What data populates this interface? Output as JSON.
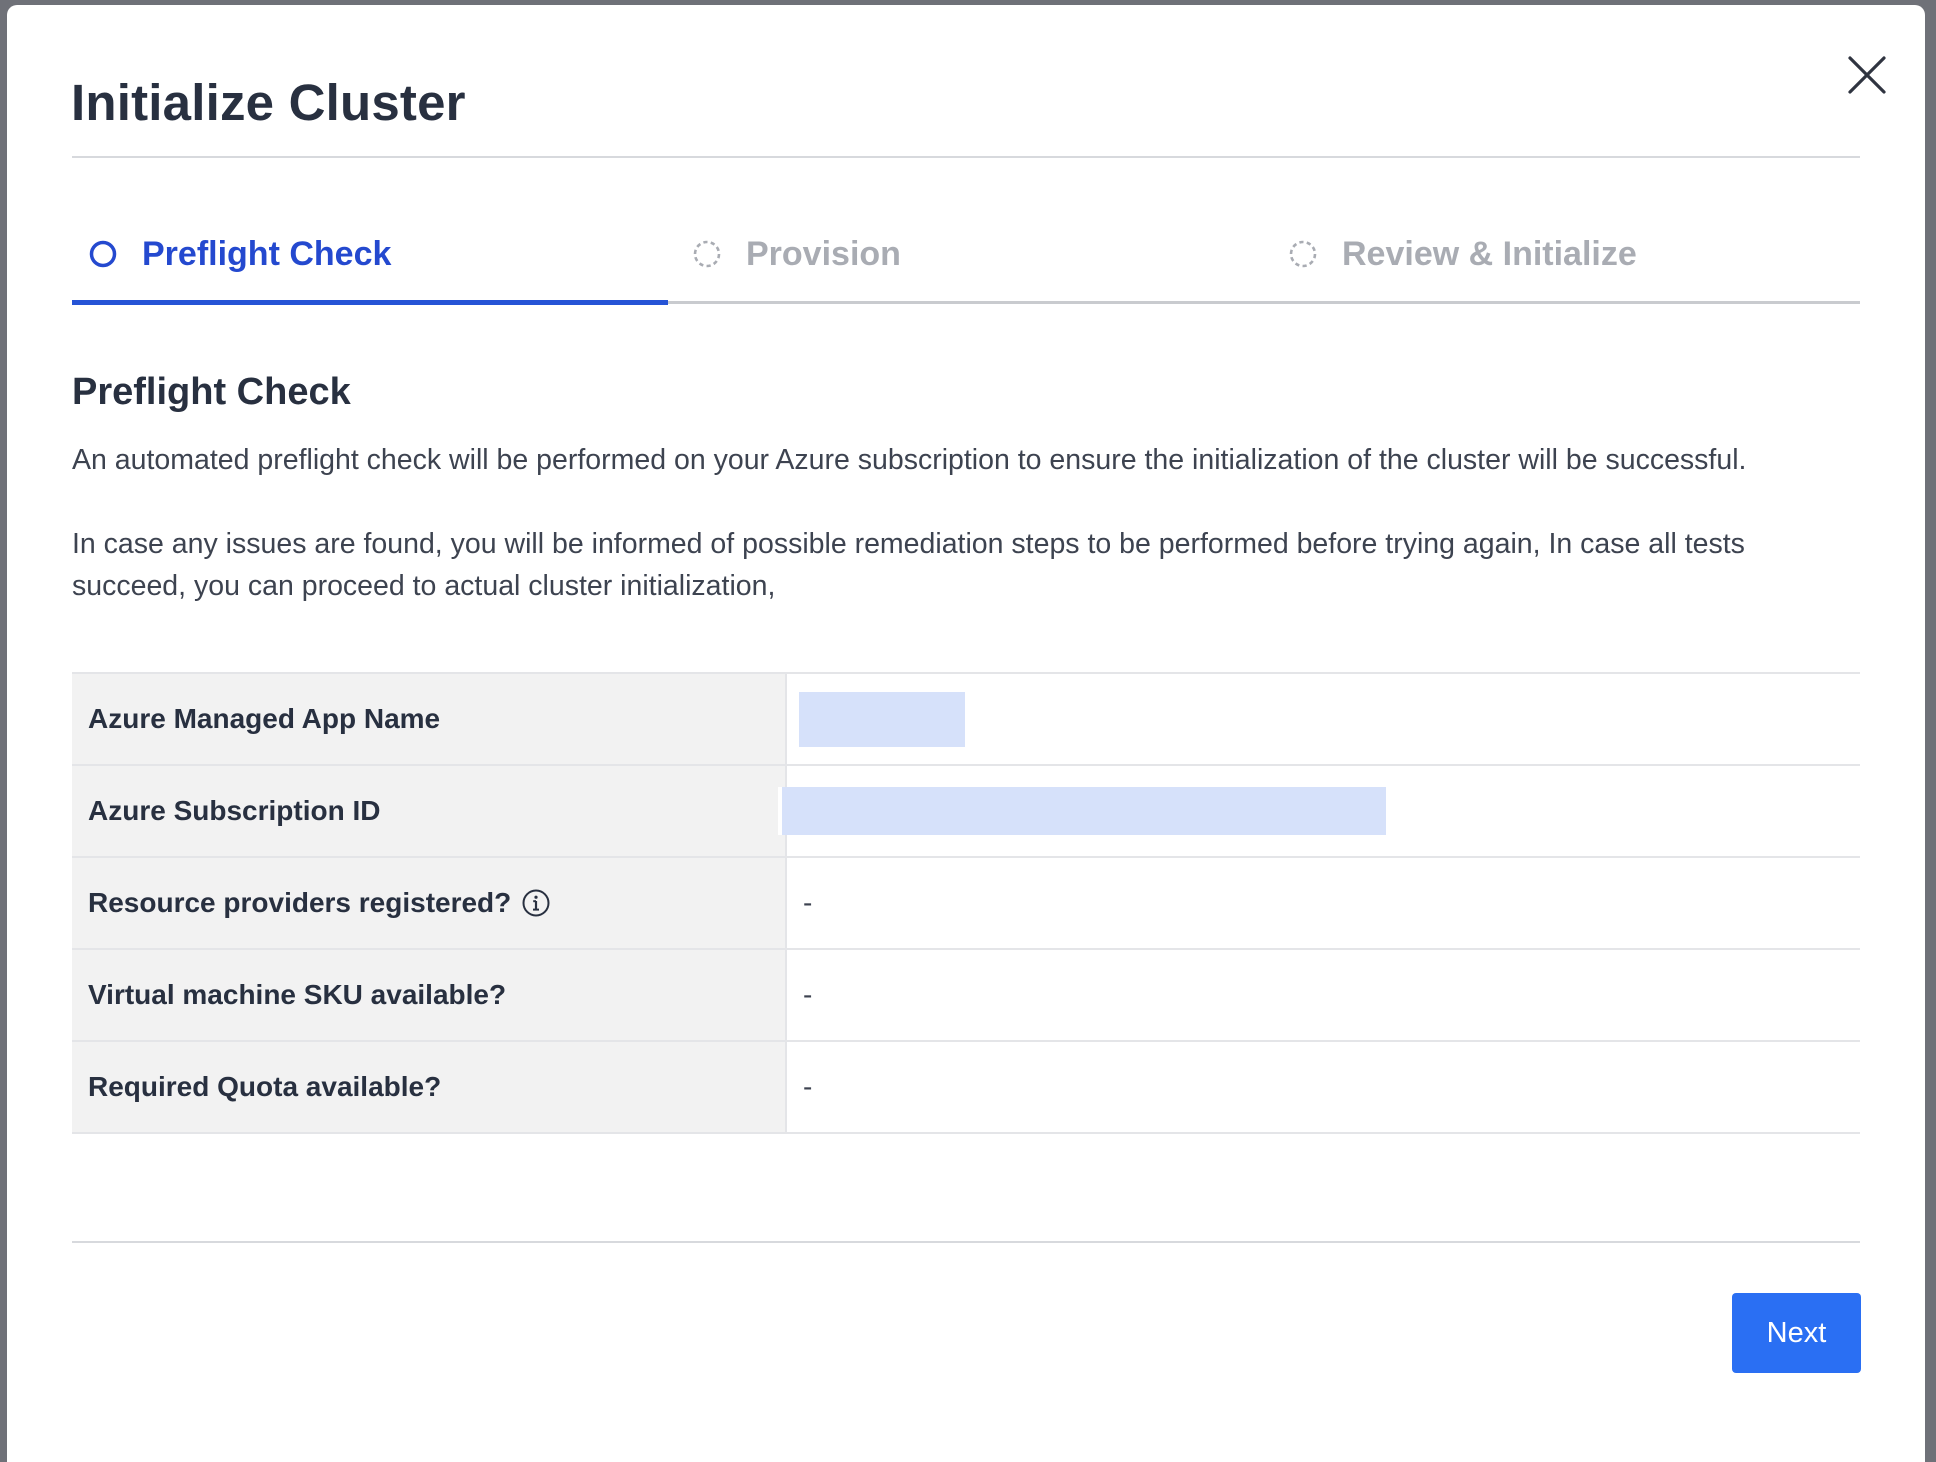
{
  "modal": {
    "title": "Initialize Cluster",
    "close_icon": "close-icon"
  },
  "steps": [
    {
      "label": "Preflight Check",
      "state": "active",
      "icon": "circle-outline-icon"
    },
    {
      "label": "Provision",
      "state": "pending",
      "icon": "dashed-circle-icon"
    },
    {
      "label": "Review & Initialize",
      "state": "pending",
      "icon": "dashed-circle-icon"
    }
  ],
  "content": {
    "section_title": "Preflight Check",
    "paragraph_1": "An automated preflight check will be performed on your Azure subscription to ensure the initialization of the cluster will be successful.",
    "paragraph_2": "In case any issues are found, you will be informed of possible remediation steps to be performed before trying again, In case all tests succeed, you can proceed to actual cluster initialization,"
  },
  "table": {
    "rows": [
      {
        "label": "Azure Managed App Name",
        "value": ""
      },
      {
        "label": "Azure Subscription ID",
        "value": ""
      },
      {
        "label": "Resource providers registered?",
        "value": "-",
        "icon": "info-icon"
      },
      {
        "label": "Virtual machine SKU available?",
        "value": "-"
      },
      {
        "label": "Required Quota available?",
        "value": "-"
      }
    ]
  },
  "footer": {
    "next_label": "Next"
  },
  "colors": {
    "primary": "#2a6ff3",
    "active_step": "#2449cf",
    "inactive_step": "#a9acb3",
    "redacted": "#d6e1fa"
  }
}
